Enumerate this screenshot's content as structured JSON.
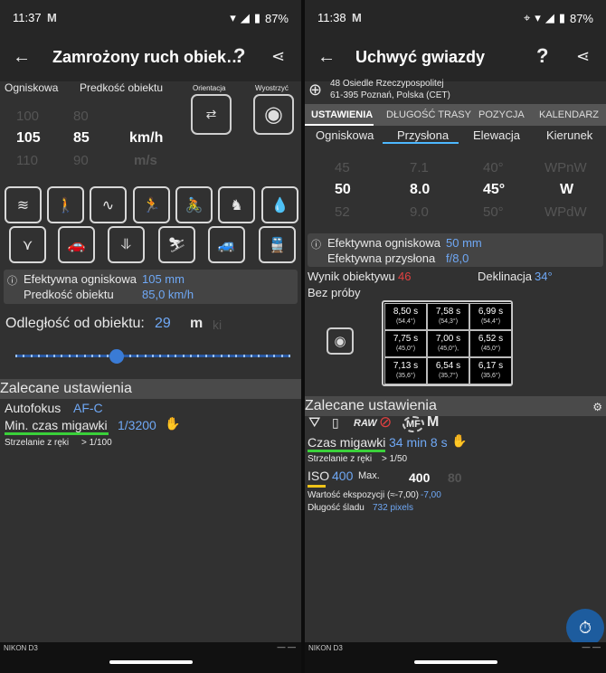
{
  "left": {
    "status": {
      "time": "11:37",
      "gmail": "M",
      "battery": "87%"
    },
    "appbar": {
      "title": "Zamrożony ruch obiek…",
      "help": "?"
    },
    "col_headers": {
      "focal": "Ogniskowa",
      "speed": "Predkość obiektu",
      "orientation": "Orientacja",
      "sharpen": "Wyostrzyć"
    },
    "focal": {
      "above": "100",
      "selected": "105",
      "below": "110"
    },
    "speed": {
      "above": "80",
      "selected": "85",
      "below": "90"
    },
    "unit": {
      "selected": "km/h",
      "below": "m/s"
    },
    "activities": [
      "river",
      "walking",
      "road",
      "running",
      "cycling",
      "horse",
      "drop",
      "bird",
      "car-front",
      "waterfall",
      "skiing",
      "car-side",
      "train"
    ],
    "info": {
      "label1": "Efektywna ogniskowa",
      "value1": "105 mm",
      "label2": "Predkość obiektu",
      "value2": "85,0 km/h"
    },
    "distance": {
      "label": "Odległość od obiektu:",
      "value": "29",
      "unit": "m",
      "unit2": "ki",
      "slider_fraction": 0.37
    },
    "recommended": {
      "header": "Zalecane ustawienia",
      "autofocus_label": "Autofokus",
      "autofocus_value": "AF-C",
      "shutter_label": "Min. czas migawki",
      "shutter_value": "1/3200",
      "handheld_label": "Strzelanie z ręki",
      "handheld_value": "> 1/100"
    },
    "bottom": {
      "device": "NIKON D3",
      "dash": "—  —"
    }
  },
  "right": {
    "status": {
      "time": "11:38",
      "gmail": "M",
      "battery": "87%"
    },
    "appbar": {
      "title": "Uchwyć gwiazdy",
      "help": "?"
    },
    "location": {
      "line1": "48 Osiedle Rzeczypospolitej",
      "line2": "61-395 Poznań, Polska (CET)"
    },
    "tabs": [
      "USTAWIENIA",
      "DŁUGOŚĆ TRASY",
      "POZYCJA",
      "KALENDARZ"
    ],
    "subtabs": [
      "Ogniskowa",
      "Przysłona",
      "Elewacja",
      "Kierunek"
    ],
    "picker": {
      "focal": {
        "above": "45",
        "selected": "50",
        "below": "52"
      },
      "aperture": {
        "above": "7.1",
        "selected": "8.0",
        "below": "9.0"
      },
      "elevation": {
        "above": "40°",
        "selected": "45°",
        "below": "50°"
      },
      "direction": {
        "above": "WPnW",
        "selected": "W",
        "below": "WPdW"
      }
    },
    "info": {
      "label1": "Efektywna ogniskowa",
      "value1": "50 mm",
      "label2": "Efektywna przysłona",
      "value2": "f/8,0"
    },
    "result": {
      "lens_label": "Wynik obiektywu",
      "lens_value": "46",
      "decl_label": "Deklinacja",
      "decl_value": "34°",
      "trial": "Bez próby"
    },
    "grid": [
      {
        "t": "8,50 s",
        "a": "(54,4°)"
      },
      {
        "t": "7,58 s",
        "a": "(54,3°)"
      },
      {
        "t": "6,99 s",
        "a": "(54,4°)"
      },
      {
        "t": "7,75 s",
        "a": "(45,0°)"
      },
      {
        "t": "7,00 s",
        "a": "(45,0°),"
      },
      {
        "t": "6,52 s",
        "a": "(45,0°)"
      },
      {
        "t": "7,13 s",
        "a": "(35,6°)"
      },
      {
        "t": "6,54 s",
        "a": "(35,7°)"
      },
      {
        "t": "6,17 s",
        "a": "(35,6°)"
      }
    ],
    "recommended": {
      "header": "Zalecane ustawienia",
      "raw": "RAW",
      "mf": "MF",
      "m": "M",
      "shutter_label": "Czas migawki",
      "shutter_value": "34 min 8 s",
      "handheld_label": "Strzelanie z ręki",
      "handheld_value": "> 1/50",
      "iso_label": "ISO",
      "iso_value": "400",
      "iso_max": "Max.",
      "iso_max_value": "400",
      "iso_next": "80",
      "ev_label": "Wartość ekspozycji (≈-7,00)",
      "ev_value": "-7,00",
      "trail_label": "Długość śladu",
      "trail_value": "732 pixels"
    },
    "bottom": {
      "device": "NIKON D3",
      "dash": "—  —"
    }
  },
  "colors": {
    "accent_blue": "#6fa8f5",
    "red": "#e24040",
    "green": "#3ad13a",
    "yellow": "#f0c419"
  }
}
